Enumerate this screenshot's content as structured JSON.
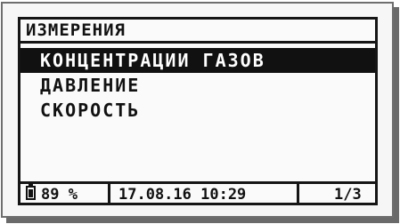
{
  "screen": {
    "title": "ИЗМЕРЕНИЯ",
    "menu": [
      {
        "label": "КОНЦЕНТРАЦИИ ГАЗОВ",
        "selected": true
      },
      {
        "label": "ДАВЛЕНИЕ",
        "selected": false
      },
      {
        "label": "СКОРОСТЬ",
        "selected": false
      }
    ],
    "status": {
      "battery_icon": "battery-icon",
      "battery": "89 %",
      "datetime": "17.08.16 10:29",
      "page": "1/3"
    }
  },
  "colors": {
    "lcd_background": "#fafafa",
    "pixel_dark": "#111111",
    "bezel_shadow": "#6a6a6a"
  }
}
